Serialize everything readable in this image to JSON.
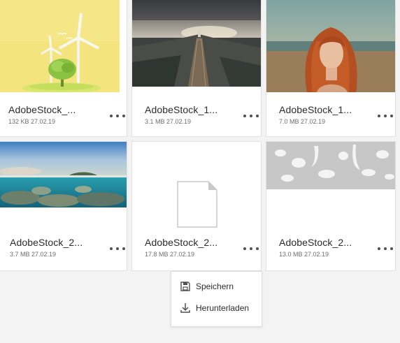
{
  "colors": {
    "background": "#f3f3f3",
    "card": "#ffffff",
    "text": "#2c2c2c",
    "meta": "#6e6e6e"
  },
  "assets": [
    {
      "name": "AdobeStock_...",
      "meta": "132 KB 27.02.19",
      "thumb": "wind-turbines-tree-illustration"
    },
    {
      "name": "AdobeStock_1...",
      "meta": "3.1 MB 27.02.19",
      "thumb": "coastal-path-lighthouse-photo"
    },
    {
      "name": "AdobeStock_1...",
      "meta": "7.0 MB 27.02.19",
      "thumb": "red-haired-woman-portrait"
    },
    {
      "name": "AdobeStock_2...",
      "meta": "3.7 MB 27.02.19",
      "thumb": "coral-reef-panorama"
    },
    {
      "name": "AdobeStock_2...",
      "meta": "17.8 MB 27.02.19",
      "thumb": "generic-file-icon"
    },
    {
      "name": "AdobeStock_2...",
      "meta": "13.0 MB 27.02.19",
      "thumb": "milk-splash-set"
    }
  ],
  "context_menu": {
    "items": [
      {
        "label": "Speichern",
        "icon": "save-icon"
      },
      {
        "label": "Herunterladen",
        "icon": "download-icon"
      }
    ]
  }
}
